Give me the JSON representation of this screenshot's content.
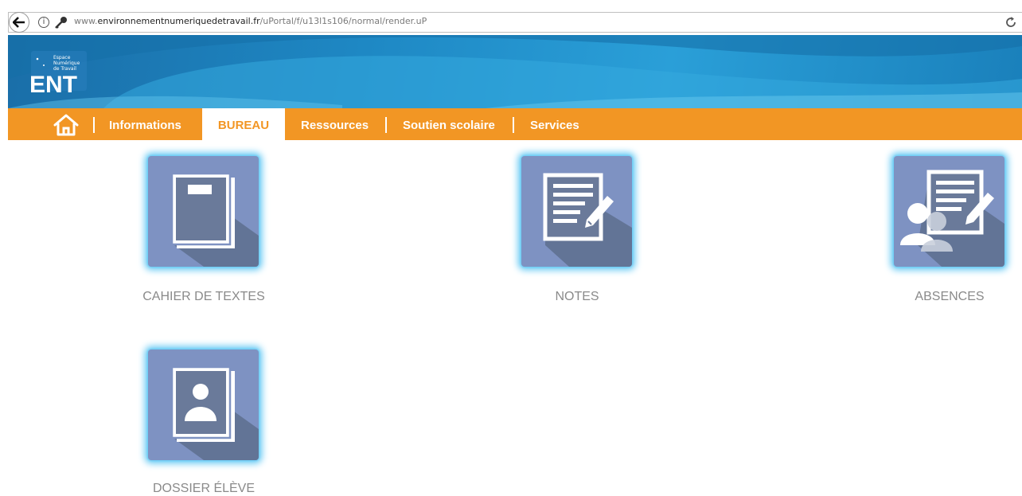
{
  "browser": {
    "url_prefix": "www.",
    "url_domain": "environnementnumeriquedetravail.fr",
    "url_path": "/uPortal/f/u13l1s106/normal/render.uP",
    "icons": [
      "back-icon",
      "info-icon",
      "key-icon",
      "reload-icon"
    ]
  },
  "header": {
    "logo_text": "ENT",
    "logo_lines": [
      "Espace",
      "Numérique",
      "de Travail"
    ],
    "colors": {
      "banner": "#1e88c4",
      "nav": "#f29624",
      "tile": "#7e92c2",
      "glow": "#5fc7f3"
    }
  },
  "nav": {
    "items": [
      {
        "label": "Informations",
        "active": false
      },
      {
        "label": "BUREAU",
        "active": true
      },
      {
        "label": "Ressources",
        "active": false
      },
      {
        "label": "Soutien scolaire",
        "active": false
      },
      {
        "label": "Services",
        "active": false
      }
    ]
  },
  "tiles": [
    {
      "label": "CAHIER DE TEXTES",
      "icon": "notebook-icon"
    },
    {
      "label": "NOTES",
      "icon": "document-pencil-icon"
    },
    {
      "label": "ABSENCES",
      "icon": "users-document-icon"
    },
    {
      "label": "DOSSIER ÉLÈVE",
      "icon": "student-file-icon"
    }
  ]
}
